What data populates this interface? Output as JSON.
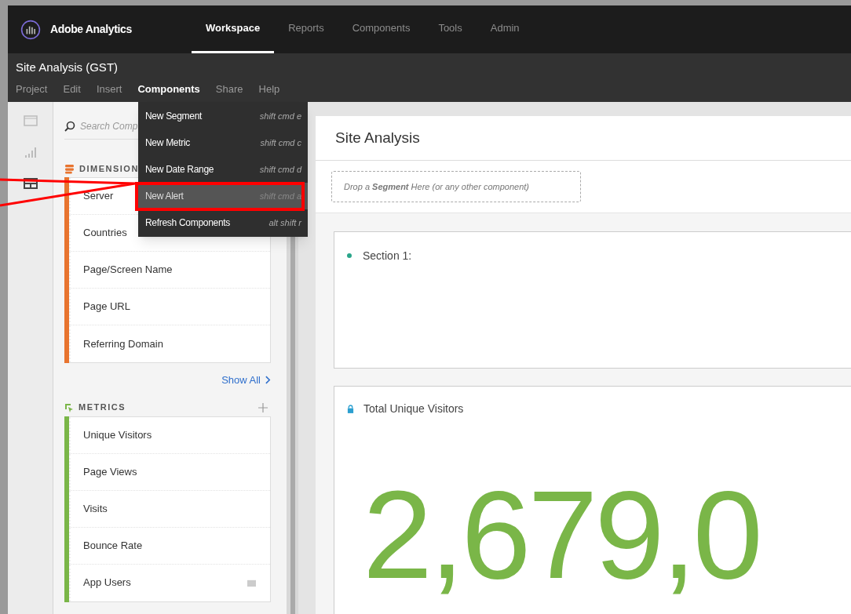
{
  "app": {
    "name": "Adobe Analytics",
    "nav": [
      {
        "label": "Workspace",
        "selected": true
      },
      {
        "label": "Reports",
        "selected": false
      },
      {
        "label": "Components",
        "selected": false
      },
      {
        "label": "Tools",
        "selected": false
      },
      {
        "label": "Admin",
        "selected": false
      }
    ]
  },
  "project": {
    "title": "Site Analysis (GST)",
    "menu": [
      {
        "label": "Project",
        "selected": false
      },
      {
        "label": "Edit",
        "selected": false
      },
      {
        "label": "Insert",
        "selected": false
      },
      {
        "label": "Components",
        "selected": true
      },
      {
        "label": "Share",
        "selected": false
      },
      {
        "label": "Help",
        "selected": false
      }
    ]
  },
  "dropdown": [
    {
      "label": "New Segment",
      "shortcut": "shift cmd e",
      "selected": false,
      "annotated": false
    },
    {
      "label": "New Metric",
      "shortcut": "shift cmd c",
      "selected": false,
      "annotated": false
    },
    {
      "label": "New Date Range",
      "shortcut": "shift cmd d",
      "selected": false,
      "annotated": false
    },
    {
      "label": "New Alert",
      "shortcut": "shift cmd a",
      "selected": true,
      "annotated": true
    },
    {
      "label": "Refresh Components",
      "shortcut": "alt shift r",
      "selected": false,
      "annotated": false
    }
  ],
  "rail": [
    {
      "kind": "panels",
      "selected": false
    },
    {
      "kind": "visualizations",
      "selected": false
    },
    {
      "kind": "components",
      "selected": true
    }
  ],
  "panel": {
    "search": {
      "placeholder": "Search Comp"
    },
    "groups": [
      {
        "kind": "dimensions",
        "heading": "DIMENSION",
        "color": "#e8742f",
        "items": [
          {
            "label": "Server"
          },
          {
            "label": "Countries"
          },
          {
            "label": "Page/Screen Name"
          },
          {
            "label": "Page URL"
          },
          {
            "label": "Referring Domain"
          }
        ],
        "show_all": "Show All"
      },
      {
        "kind": "metrics",
        "heading": "METRICS",
        "color": "#7ab648",
        "items": [
          {
            "label": "Unique Visitors"
          },
          {
            "label": "Page Views"
          },
          {
            "label": "Visits"
          },
          {
            "label": "Bounce Rate"
          },
          {
            "label": "App Users",
            "calculated": true
          }
        ]
      }
    ]
  },
  "project_panel": {
    "title": "Site Analysis",
    "drop_zone": "Drop a **Segment** Here (or any other component)",
    "section": "Section 1:",
    "metric_title": "Total Unique Visitors",
    "metric_value": "2,679,0"
  }
}
